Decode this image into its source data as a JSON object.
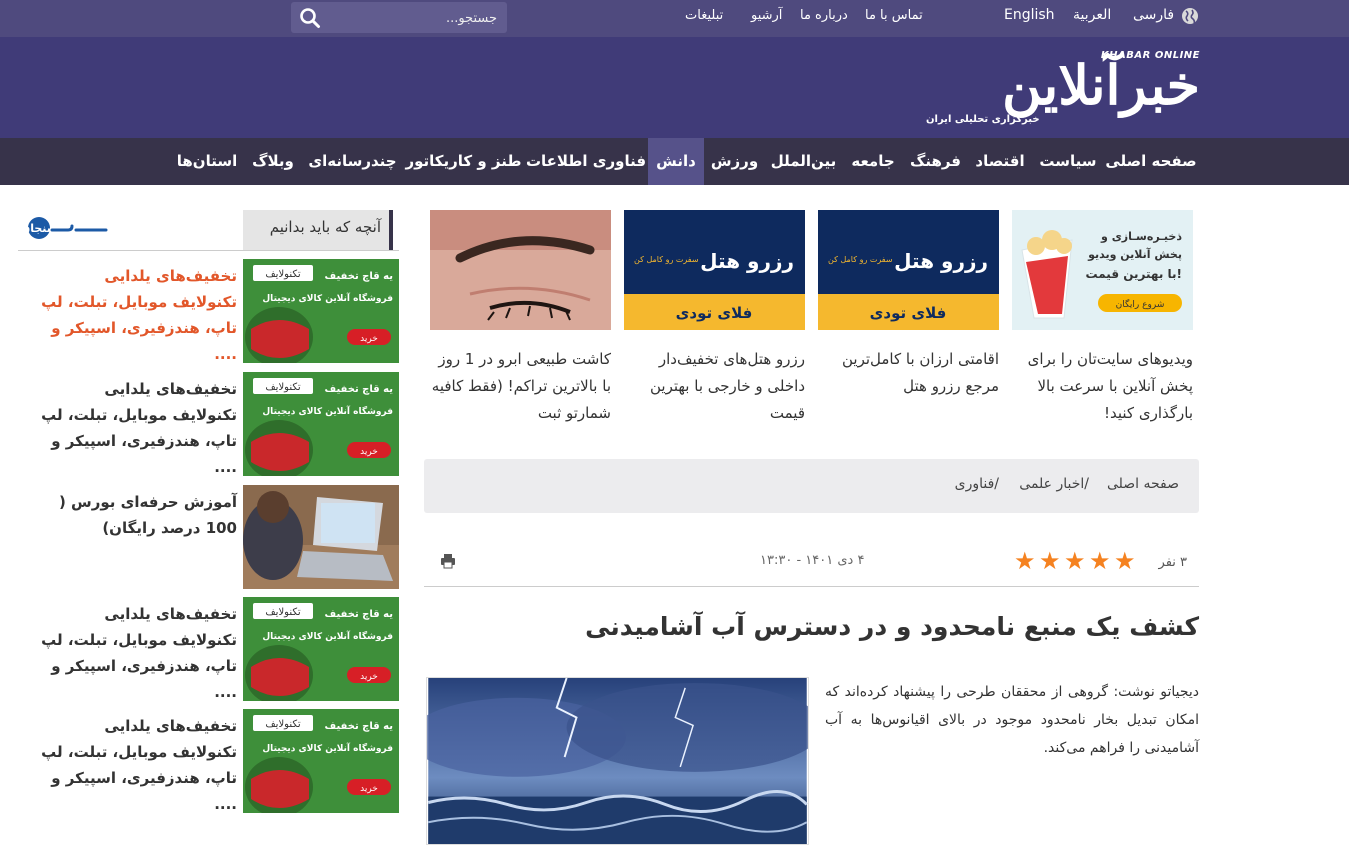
{
  "topbar": {
    "search_placeholder": "جستجو...",
    "links": [
      "تبلیغات",
      "آرشیو",
      "درباره ما",
      "تماس با ما"
    ],
    "languages": [
      "English",
      "العربية",
      "فارسی"
    ]
  },
  "header": {
    "logo_en": "KHABAR ONLINE",
    "logo_fa": "خبرآنلاین",
    "tagline": "خبرگزاری تحلیلی ایران"
  },
  "nav": {
    "items": [
      "صفحه اصلی",
      "سیاست",
      "اقتصاد",
      "فرهنگ",
      "جامعه",
      "بین‌الملل",
      "ورزش",
      "دانش",
      "فناوری اطلاعات",
      "طنز و کاریکاتور",
      "چندرسانه‌ای",
      "وبلاگ",
      "استان‌ها"
    ],
    "active": "دانش"
  },
  "aside": {
    "heading": "آنچه که باید بدانیم",
    "brand": "سنجاق",
    "items": [
      {
        "text": "تخفیف‌های یلدایی تکنولایف موبایل، تبلت، لپ تاپ، هندزفیری، اسپیکر و ....",
        "highlight": true,
        "ad_title": "یه قاچ تخفیف",
        "ad_sub": "فروشگاه آنلاین کالای دیجیتال",
        "ad_brand": "تکنولایف",
        "ad_button": "خرید"
      },
      {
        "text": "تخفیف‌های یلدایی تکنولایف موبایل، تبلت، لپ تاپ، هندزفیری، اسپیکر و ....",
        "highlight": false,
        "ad_title": "یه قاچ تخفیف",
        "ad_sub": "فروشگاه آنلاین کالای دیجیتال",
        "ad_brand": "تکنولایف",
        "ad_button": "خرید"
      },
      {
        "text": "آموزش حرفه‌ای بورس ( 100 درصد رایگان)",
        "highlight": false
      },
      {
        "text": "تخفیف‌های یلدایی تکنولایف موبایل، تبلت، لپ تاپ، هندزفیری، اسپیکر و ....",
        "highlight": false,
        "ad_title": "یه قاچ تخفیف",
        "ad_sub": "فروشگاه آنلاین کالای دیجیتال",
        "ad_brand": "تکنولایف",
        "ad_button": "خرید"
      },
      {
        "text": "تخفیف‌های یلدایی تکنولایف موبایل، تبلت، لپ تاپ، هندزفیری، اسپیکر و ....",
        "highlight": false,
        "ad_title": "یه قاچ تخفیف",
        "ad_sub": "فروشگاه آنلاین کالای دیجیتال",
        "ad_brand": "تکنولایف",
        "ad_button": "خرید"
      }
    ]
  },
  "cards": [
    {
      "text": "ویدیوهای سایت‌تان را برای پخش آنلاین با سرعت بالا بارگذاری کنید!",
      "img_line1": "ذخیـره‌سـازی و",
      "img_line2": "پخش آنلاین ویدیو",
      "img_line3": "با بهترین قیمت!",
      "img_button": "شروع رایگان"
    },
    {
      "text": "اقامتی ارزان با کامل‌ترین مرجع رزرو هتل",
      "img_line1": "رزرو هتل",
      "img_line2": "سفرت رو کامل کن",
      "img_line3": "فلای تودی"
    },
    {
      "text": "رزرو هتل‌های تخفیف‌دار داخلی و خارجی با بهترین قیمت",
      "img_line1": "رزرو هتل",
      "img_line2": "سفرت رو کامل کن",
      "img_line3": "فلای تودی"
    },
    {
      "text": "کاشت طبیعی ابرو در 1 روز با بالاترین تراکم! (فقط کافیه شمارتو ثبت"
    }
  ],
  "breadcrumb": [
    "صفحه اصلی",
    "/اخبار علمی",
    "/فناوری"
  ],
  "article": {
    "rating_count": "۳ نفر",
    "rating": 5,
    "date": "۴ دی ۱۴۰۱ - ۱۳:۳۰",
    "title": "کشف یک منبع نامحدود و در دسترس آب آشامیدنی",
    "lead": "دیجیاتو نوشت: گروهی از محققان طرحی را پیشنهاد کرده‌اند که امکان تبدیل بخار نامحدود موجود در بالای اقیانوس‌ها به آب آشامیدنی را فراهم می‌کند."
  }
}
